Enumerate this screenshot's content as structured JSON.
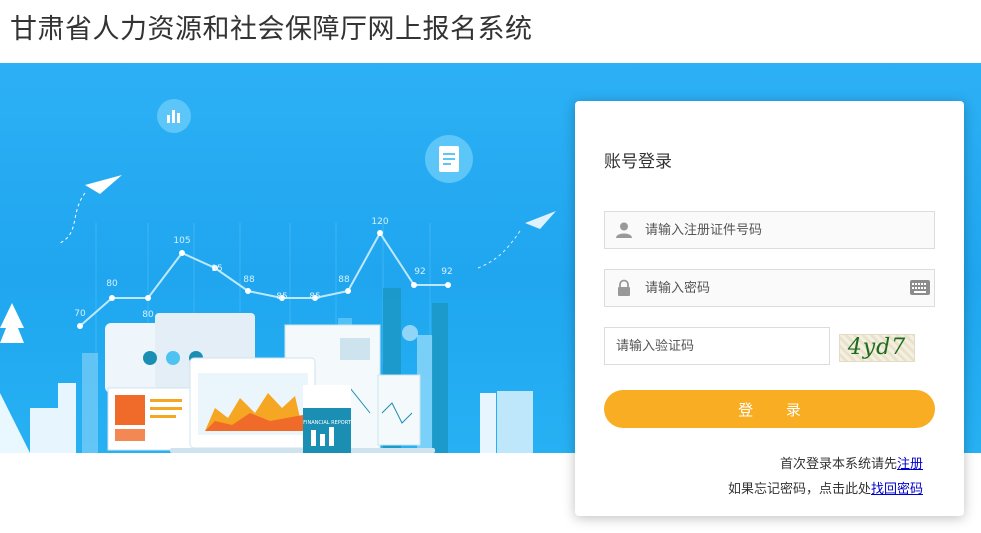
{
  "header": {
    "title": "甘肃省人力资源和社会保障厅网上报名系统"
  },
  "banner": {
    "line_chart_labels": [
      "70",
      "80",
      "80",
      "105",
      "95",
      "88",
      "85",
      "85",
      "88",
      "120",
      "92",
      "92"
    ],
    "report_cover_label": "FINANCIAL REPORT",
    "colors": {
      "background": "#23abf1",
      "orange": "#f5a623",
      "teal": "#1b8fb3"
    }
  },
  "login": {
    "title": "账号登录",
    "username_placeholder": "请输入注册证件号码",
    "password_placeholder": "请输入密码",
    "captcha_placeholder": "请输入验证码",
    "captcha_text": "4yd7",
    "login_button": "登 录",
    "register_prompt": "首次登录本系统请先",
    "register_link": "注册",
    "forgot_prompt": "如果忘记密码，点击此处",
    "forgot_link": "找回密码",
    "icons": [
      "user-icon",
      "lock-icon",
      "keyboard-icon"
    ],
    "accent_color": "#f8ad22"
  }
}
